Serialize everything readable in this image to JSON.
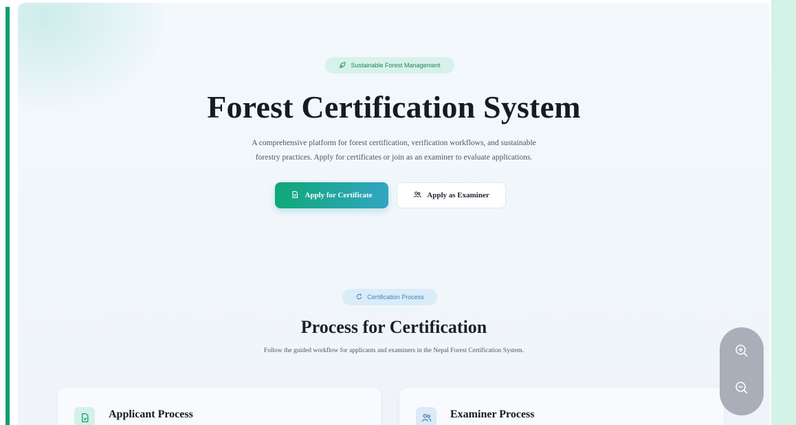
{
  "hero": {
    "badge": "Sustainable Forest Management",
    "title": "Forest Certification System",
    "description_line1": "A comprehensive platform for forest certification, verification workflows, and sustainable",
    "description_line2": "forestry practices. Apply for certificates or join as an examiner to evaluate applications.",
    "primary_button": "Apply for Certificate",
    "secondary_button": "Apply as Examiner"
  },
  "process": {
    "badge": "Certification Process",
    "title": "Process for Certification",
    "description": "Follow the guided workflow for applicants and examiners in the Nepal Forest Certification System.",
    "cards": [
      {
        "title": "Applicant Process",
        "icon": "file-check-icon"
      },
      {
        "title": "Examiner Process",
        "icon": "users-icon"
      }
    ]
  },
  "zoom_controls": {
    "zoom_in_icon": "zoom-in-icon",
    "zoom_out_icon": "zoom-out-icon"
  },
  "colors": {
    "accent_green": "#10a877",
    "accent_blue": "#32a5c3",
    "left_bar": "#0f9d6e",
    "zoom_pill": "#a9aeb9"
  }
}
